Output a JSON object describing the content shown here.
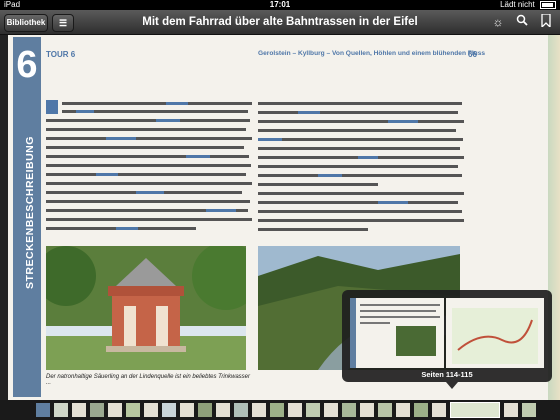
{
  "status": {
    "carrier": "iPad",
    "time": "17:01",
    "charging": "Lädt nicht"
  },
  "toolbar": {
    "library_button": "Bibliothek",
    "title": "Mit dem Fahrrad über alte Bahntrassen in der Eifel"
  },
  "book": {
    "chapter_number": "6",
    "spine_label": "STRECKENBESCHREIBUNG",
    "left_header": "TOUR 6",
    "right_header": "Gerolstein – Kyllburg – Von Quellen, Höhlen und einem blühenden Fluss",
    "page_number_right": "66",
    "caption": "Der natronhaltige Säuerling an der Lindenquelle ist ein beliebtes Trinkwasser ..."
  },
  "preview": {
    "label": "Seiten 114-115"
  },
  "colors": {
    "accent": "#4f77a8",
    "spine": "#5f7ea0",
    "toolbar": "#3a3a3a"
  }
}
